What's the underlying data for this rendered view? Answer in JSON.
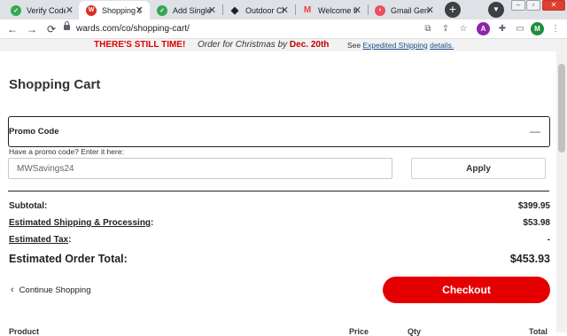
{
  "browser": {
    "tabs": [
      {
        "title": "Verify Code",
        "active": false,
        "favicon_color": "#34a853",
        "favicon": "check-icon"
      },
      {
        "title": "Shopping Cart",
        "active": true,
        "favicon_color": "#d93025",
        "favicon": "wards-icon"
      },
      {
        "title": "Add Single-Use",
        "active": false,
        "favicon_color": "#34a853",
        "favicon": "check-icon"
      },
      {
        "title": "Outdoor Clothing",
        "active": false,
        "favicon_color": "#202124",
        "favicon": "diamond-icon"
      },
      {
        "title": "Welcome to",
        "active": false,
        "favicon_color": "#ea4335",
        "favicon": "gmail-icon"
      },
      {
        "title": "Gmail Generator",
        "active": false,
        "favicon_color": "#e8505b",
        "favicon": "tag-icon"
      }
    ],
    "url": "wards.com/co/shopping-cart/",
    "profile_letters": [
      "A",
      "M"
    ],
    "profile_colors": [
      "#8e24aa",
      "#1e8e3e"
    ]
  },
  "banner": {
    "headline": "THERE'S STILL TIME!",
    "message_prefix": "Order for Christmas by",
    "message_date": "Dec. 20th",
    "see_prefix": "See",
    "see_link": "Expedited Shipping",
    "see_suffix": "details."
  },
  "page_title": "Shopping Cart",
  "promo": {
    "header_label": "Promo Code",
    "collapse_symbol": "—",
    "help_text": "Have a promo code? Enter it here:",
    "input_value": "MWSavings24",
    "apply_label": "Apply"
  },
  "summary": {
    "subtotal_label": "Subtotal:",
    "subtotal_value": "$399.95",
    "shipping_label": "Estimated Shipping & Processing",
    "shipping_value": "$53.98",
    "tax_label": "Estimated Tax",
    "tax_value": "-",
    "total_label": "Estimated Order Total:",
    "total_value": "$453.93"
  },
  "actions": {
    "continue_label": "Continue Shopping",
    "checkout_label": "Checkout"
  },
  "table_headers": [
    "Product",
    "Price",
    "Qty",
    "Total"
  ],
  "colors": {
    "accent_red": "#e40000",
    "banner_red": "#e00000",
    "link_blue": "#1a4f8a"
  }
}
